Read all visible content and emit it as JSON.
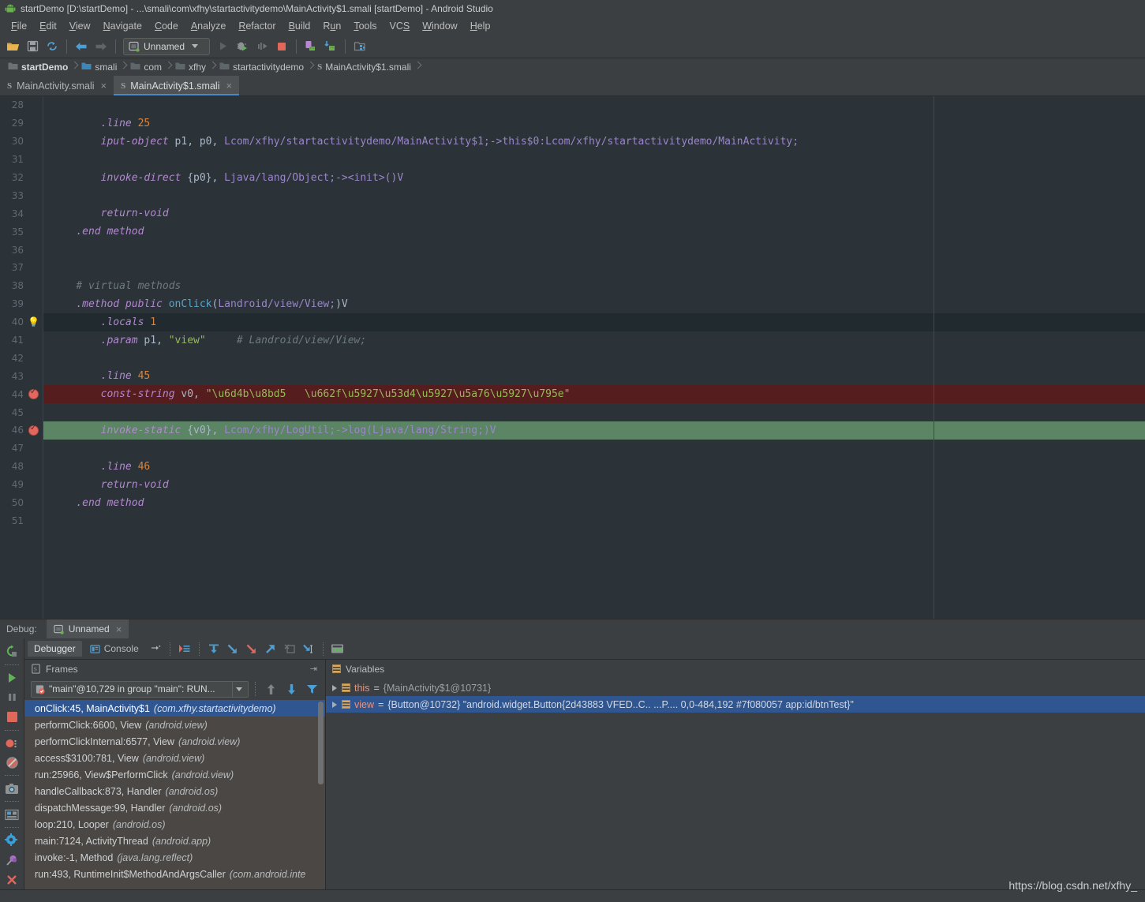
{
  "window": {
    "title": "startDemo [D:\\startDemo] - ...\\smali\\com\\xfhy\\startactivitydemo\\MainActivity$1.smali [startDemo] - Android Studio",
    "app_icon": "android-icon"
  },
  "menubar": [
    {
      "label": "File",
      "mnemonic": "F"
    },
    {
      "label": "Edit",
      "mnemonic": "E"
    },
    {
      "label": "View",
      "mnemonic": "V"
    },
    {
      "label": "Navigate",
      "mnemonic": "N"
    },
    {
      "label": "Code",
      "mnemonic": "C"
    },
    {
      "label": "Analyze",
      "mnemonic": "A"
    },
    {
      "label": "Refactor",
      "mnemonic": "R"
    },
    {
      "label": "Build",
      "mnemonic": "B"
    },
    {
      "label": "Run",
      "mnemonic": "u"
    },
    {
      "label": "Tools",
      "mnemonic": "T"
    },
    {
      "label": "VCS",
      "mnemonic": "S"
    },
    {
      "label": "Window",
      "mnemonic": "W"
    },
    {
      "label": "Help",
      "mnemonic": "H"
    }
  ],
  "toolbar": {
    "run_config": "Unnamed",
    "icons": [
      "open-folder-icon",
      "save-all-icon",
      "sync-icon",
      "back-arrow-icon",
      "forward-arrow-icon",
      "run-icon",
      "debug-icon",
      "run-coverage-icon",
      "stop-icon",
      "avd-manager-icon",
      "sdk-manager-icon",
      "device-file-explorer-icon"
    ]
  },
  "breadcrumbs": [
    {
      "label": "startDemo",
      "icon": "project-module-icon"
    },
    {
      "label": "smali",
      "icon": "folder-blue-icon"
    },
    {
      "label": "com",
      "icon": "folder-icon"
    },
    {
      "label": "xfhy",
      "icon": "folder-icon"
    },
    {
      "label": "startactivitydemo",
      "icon": "folder-icon"
    },
    {
      "label": "MainActivity$1.smali",
      "icon": "smali-file-icon"
    }
  ],
  "editor_tabs": [
    {
      "label": "MainActivity.smali",
      "active": false,
      "icon": "smali-file-icon"
    },
    {
      "label": "MainActivity$1.smali",
      "active": true,
      "icon": "smali-file-icon"
    }
  ],
  "code": {
    "first_line": 28,
    "lines": [
      {
        "n": 28,
        "state": "",
        "marker": "",
        "tokens": []
      },
      {
        "n": 29,
        "state": "",
        "marker": "",
        "tokens": [
          {
            "t": "        ",
            "c": "pl"
          },
          {
            "t": ".line ",
            "c": "kw"
          },
          {
            "t": "25",
            "c": "num"
          }
        ]
      },
      {
        "n": 30,
        "state": "",
        "marker": "",
        "tokens": [
          {
            "t": "        ",
            "c": "pl"
          },
          {
            "t": "iput-object",
            "c": "kw"
          },
          {
            "t": " p1, p0, ",
            "c": "id"
          },
          {
            "t": "Lcom/xfhy/startactivitydemo/MainActivity$1;->this$0:Lcom/xfhy/startactivitydemo/MainActivity;",
            "c": "cls"
          }
        ]
      },
      {
        "n": 31,
        "state": "",
        "marker": "",
        "tokens": []
      },
      {
        "n": 32,
        "state": "",
        "marker": "",
        "tokens": [
          {
            "t": "        ",
            "c": "pl"
          },
          {
            "t": "invoke-direct",
            "c": "kw"
          },
          {
            "t": " {p0}, ",
            "c": "id"
          },
          {
            "t": "Ljava/lang/Object;-><init>()V",
            "c": "cls"
          }
        ]
      },
      {
        "n": 33,
        "state": "",
        "marker": "",
        "tokens": []
      },
      {
        "n": 34,
        "state": "",
        "marker": "",
        "tokens": [
          {
            "t": "        ",
            "c": "pl"
          },
          {
            "t": "return-void",
            "c": "kw"
          }
        ]
      },
      {
        "n": 35,
        "state": "",
        "marker": "",
        "tokens": [
          {
            "t": "    ",
            "c": "pl"
          },
          {
            "t": ".end method",
            "c": "kw"
          }
        ]
      },
      {
        "n": 36,
        "state": "",
        "marker": "",
        "tokens": []
      },
      {
        "n": 37,
        "state": "",
        "marker": "",
        "tokens": []
      },
      {
        "n": 38,
        "state": "",
        "marker": "",
        "tokens": [
          {
            "t": "    ",
            "c": "pl"
          },
          {
            "t": "# virtual methods",
            "c": "cmt"
          }
        ]
      },
      {
        "n": 39,
        "state": "",
        "marker": "",
        "tokens": [
          {
            "t": "    ",
            "c": "pl"
          },
          {
            "t": ".method public ",
            "c": "kw"
          },
          {
            "t": "onClick",
            "c": "mth"
          },
          {
            "t": "(",
            "c": "id"
          },
          {
            "t": "Landroid/view/View;",
            "c": "cls"
          },
          {
            "t": ")V",
            "c": "id"
          }
        ]
      },
      {
        "n": 40,
        "state": "caret",
        "marker": "bulb",
        "tokens": [
          {
            "t": "        ",
            "c": "pl"
          },
          {
            "t": ".locals ",
            "c": "kw"
          },
          {
            "t": "1",
            "c": "num"
          }
        ]
      },
      {
        "n": 41,
        "state": "",
        "marker": "",
        "tokens": [
          {
            "t": "        ",
            "c": "pl"
          },
          {
            "t": ".param",
            "c": "kw"
          },
          {
            "t": " p1, ",
            "c": "id"
          },
          {
            "t": "\"view\"",
            "c": "str"
          },
          {
            "t": "     ",
            "c": "pl"
          },
          {
            "t": "# Landroid/view/View;",
            "c": "cmt"
          }
        ]
      },
      {
        "n": 42,
        "state": "",
        "marker": "",
        "tokens": []
      },
      {
        "n": 43,
        "state": "",
        "marker": "",
        "tokens": [
          {
            "t": "        ",
            "c": "pl"
          },
          {
            "t": ".line ",
            "c": "kw"
          },
          {
            "t": "45",
            "c": "num"
          }
        ]
      },
      {
        "n": 44,
        "state": "bp-red",
        "marker": "breakpoint",
        "tokens": [
          {
            "t": "        ",
            "c": "pl"
          },
          {
            "t": "const-string",
            "c": "kw"
          },
          {
            "t": " v0, ",
            "c": "id"
          },
          {
            "t": "\"\\u6d4b\\u8bd5   \\u662f\\u5927\\u53d4\\u5927\\u5a76\\u5927\\u795e\"",
            "c": "str"
          }
        ]
      },
      {
        "n": 45,
        "state": "",
        "marker": "",
        "tokens": []
      },
      {
        "n": 46,
        "state": "bp-green",
        "marker": "breakpoint",
        "tokens": [
          {
            "t": "        ",
            "c": "pl"
          },
          {
            "t": "invoke-static",
            "c": "kw"
          },
          {
            "t": " {v0}, ",
            "c": "id"
          },
          {
            "t": "Lcom/xfhy/LogUtil;->log(Ljava/lang/String;)V",
            "c": "cls"
          }
        ]
      },
      {
        "n": 47,
        "state": "",
        "marker": "",
        "tokens": []
      },
      {
        "n": 48,
        "state": "",
        "marker": "",
        "tokens": [
          {
            "t": "        ",
            "c": "pl"
          },
          {
            "t": ".line ",
            "c": "kw"
          },
          {
            "t": "46",
            "c": "num"
          }
        ]
      },
      {
        "n": 49,
        "state": "",
        "marker": "",
        "tokens": [
          {
            "t": "        ",
            "c": "pl"
          },
          {
            "t": "return-void",
            "c": "kw"
          }
        ]
      },
      {
        "n": 50,
        "state": "",
        "marker": "",
        "tokens": [
          {
            "t": "    ",
            "c": "pl"
          },
          {
            "t": ".end method",
            "c": "kw"
          }
        ]
      },
      {
        "n": 51,
        "state": "",
        "marker": "",
        "tokens": []
      }
    ]
  },
  "debug": {
    "label": "Debug:",
    "session_tab": "Unnamed",
    "tabs": [
      {
        "label": "Debugger",
        "active": true,
        "icon": ""
      },
      {
        "label": "Console",
        "active": false,
        "icon": "console-icon"
      }
    ],
    "toolbar_icons": [
      "rerun-icon",
      "resume-program-icon",
      "pause-program-icon",
      "stop-program-icon",
      "view-breakpoints-icon",
      "mute-breakpoints-icon",
      "screenshot-icon",
      "layout-inspector-icon",
      "settings-gear-icon",
      "pin-icon",
      "close-icon"
    ],
    "stepper_icons": [
      "show-execution-point-icon",
      "step-over-icon",
      "step-into-icon",
      "force-step-into-icon",
      "step-out-icon",
      "drop-frame-icon",
      "run-to-cursor-icon",
      "evaluate-expression-icon"
    ],
    "frames": {
      "title": "Frames",
      "thread": "\"main\"@10,729 in group \"main\": RUN...",
      "list": [
        {
          "method": "onClick:45, MainActivity$1",
          "pkg": "(com.xfhy.startactivitydemo)",
          "selected": true
        },
        {
          "method": "performClick:6600, View",
          "pkg": "(android.view)",
          "selected": false
        },
        {
          "method": "performClickInternal:6577, View",
          "pkg": "(android.view)",
          "selected": false
        },
        {
          "method": "access$3100:781, View",
          "pkg": "(android.view)",
          "selected": false
        },
        {
          "method": "run:25966, View$PerformClick",
          "pkg": "(android.view)",
          "selected": false
        },
        {
          "method": "handleCallback:873, Handler",
          "pkg": "(android.os)",
          "selected": false
        },
        {
          "method": "dispatchMessage:99, Handler",
          "pkg": "(android.os)",
          "selected": false
        },
        {
          "method": "loop:210, Looper",
          "pkg": "(android.os)",
          "selected": false
        },
        {
          "method": "main:7124, ActivityThread",
          "pkg": "(android.app)",
          "selected": false
        },
        {
          "method": "invoke:-1, Method",
          "pkg": "(java.lang.reflect)",
          "selected": false
        },
        {
          "method": "run:493, RuntimeInit$MethodAndArgsCaller",
          "pkg": "(com.android.inte",
          "selected": false
        }
      ]
    },
    "variables": {
      "title": "Variables",
      "list": [
        {
          "name": "this",
          "eq": "=",
          "value": "{MainActivity$1@10731}",
          "selected": false
        },
        {
          "name": "view",
          "eq": "=",
          "value": "{Button@10732} \"android.widget.Button{2d43883 VFED..C.. ...P.... 0,0-484,192 #7f080057 app:id/btnTest}\"",
          "selected": true
        }
      ]
    }
  },
  "watermark": "https://blog.csdn.net/xfhy_",
  "colors": {
    "chrome_bg": "#3c3f41",
    "editor_bg": "#2b3238",
    "breakpoint_line": "#551d1d",
    "current_line": "#5b8564",
    "selection_blue": "#2f5691",
    "accent_blue": "#4a88c7"
  }
}
